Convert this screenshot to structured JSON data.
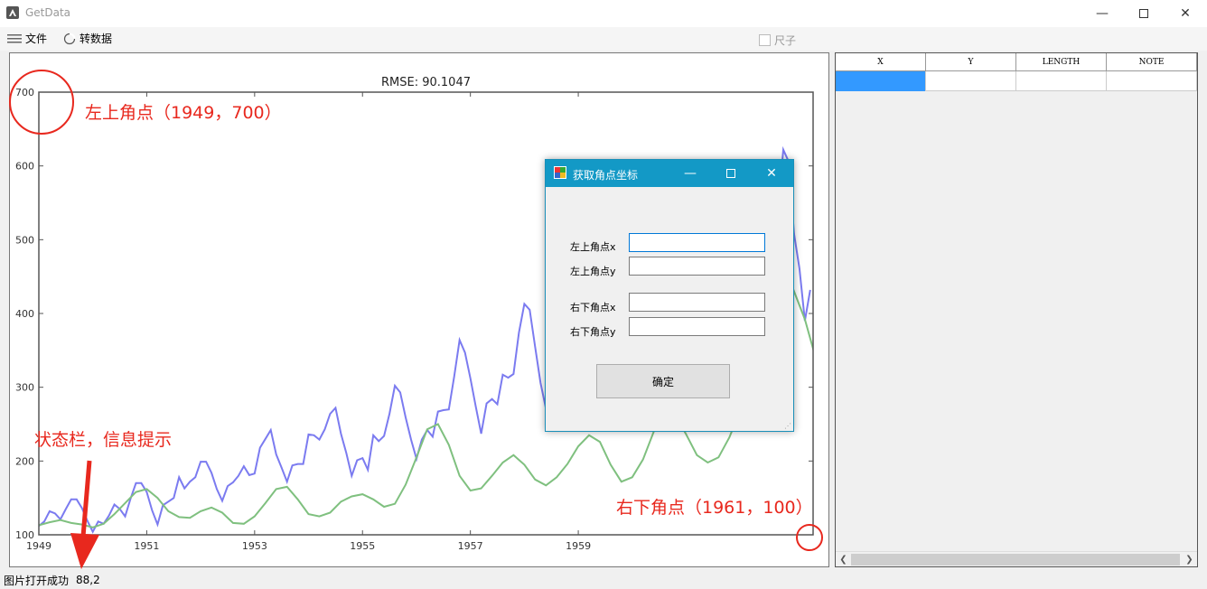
{
  "window": {
    "title": "GetData"
  },
  "menu": {
    "file": "文件",
    "convert": "转数据",
    "ruler": "尺子"
  },
  "chart_data": {
    "type": "line",
    "title": "RMSE: 90.1047",
    "xlabel": "",
    "ylabel": "",
    "xlim": [
      1949,
      1961
    ],
    "ylim": [
      100,
      700
    ],
    "xticks": [
      1949,
      1951,
      1953,
      1955,
      1957,
      1959
    ],
    "yticks": [
      100,
      200,
      300,
      400,
      500,
      600,
      700
    ],
    "grid": false,
    "legend": "none",
    "series": [
      {
        "color": "#7b7bf0",
        "points": [
          [
            1949.0,
            112
          ],
          [
            1949.1,
            118
          ],
          [
            1949.2,
            132
          ],
          [
            1949.3,
            129
          ],
          [
            1949.4,
            121
          ],
          [
            1949.5,
            135
          ],
          [
            1949.6,
            148
          ],
          [
            1949.7,
            148
          ],
          [
            1949.8,
            136
          ],
          [
            1949.9,
            119
          ],
          [
            1950.0,
            104
          ],
          [
            1950.1,
            118
          ],
          [
            1950.2,
            115
          ],
          [
            1950.3,
            126
          ],
          [
            1950.4,
            141
          ],
          [
            1950.5,
            135
          ],
          [
            1950.6,
            125
          ],
          [
            1950.7,
            149
          ],
          [
            1950.8,
            170
          ],
          [
            1950.9,
            170
          ],
          [
            1951.0,
            158
          ],
          [
            1951.1,
            133
          ],
          [
            1951.2,
            114
          ],
          [
            1951.3,
            140
          ],
          [
            1951.4,
            145
          ],
          [
            1951.5,
            150
          ],
          [
            1951.6,
            178
          ],
          [
            1951.7,
            163
          ],
          [
            1951.8,
            172
          ],
          [
            1951.9,
            178
          ],
          [
            1952.0,
            199
          ],
          [
            1952.1,
            199
          ],
          [
            1952.2,
            184
          ],
          [
            1952.3,
            162
          ],
          [
            1952.4,
            146
          ],
          [
            1952.5,
            166
          ],
          [
            1952.6,
            171
          ],
          [
            1952.7,
            180
          ],
          [
            1952.8,
            193
          ],
          [
            1952.9,
            181
          ],
          [
            1953.0,
            183
          ],
          [
            1953.1,
            218
          ],
          [
            1953.2,
            230
          ],
          [
            1953.3,
            242
          ],
          [
            1953.4,
            209
          ],
          [
            1953.5,
            191
          ],
          [
            1953.6,
            172
          ],
          [
            1953.7,
            194
          ],
          [
            1953.8,
            196
          ],
          [
            1953.9,
            196
          ],
          [
            1954.0,
            236
          ],
          [
            1954.1,
            235
          ],
          [
            1954.2,
            229
          ],
          [
            1954.3,
            243
          ],
          [
            1954.4,
            264
          ],
          [
            1954.5,
            272
          ],
          [
            1954.6,
            237
          ],
          [
            1954.7,
            211
          ],
          [
            1954.8,
            180
          ],
          [
            1954.9,
            201
          ],
          [
            1955.0,
            204
          ],
          [
            1955.1,
            188
          ],
          [
            1955.2,
            235
          ],
          [
            1955.3,
            227
          ],
          [
            1955.4,
            234
          ],
          [
            1955.5,
            264
          ],
          [
            1955.6,
            302
          ],
          [
            1955.7,
            293
          ],
          [
            1955.8,
            259
          ],
          [
            1955.9,
            229
          ],
          [
            1956.0,
            203
          ],
          [
            1956.1,
            229
          ],
          [
            1956.2,
            242
          ],
          [
            1956.3,
            233
          ],
          [
            1956.4,
            267
          ],
          [
            1956.5,
            269
          ],
          [
            1956.6,
            270
          ],
          [
            1956.7,
            315
          ],
          [
            1956.8,
            364
          ],
          [
            1956.9,
            347
          ],
          [
            1957.0,
            312
          ],
          [
            1957.1,
            274
          ],
          [
            1957.2,
            237
          ],
          [
            1957.3,
            278
          ],
          [
            1957.4,
            284
          ],
          [
            1957.5,
            277
          ],
          [
            1957.6,
            317
          ],
          [
            1957.7,
            313
          ],
          [
            1957.8,
            318
          ],
          [
            1957.9,
            374
          ],
          [
            1958.0,
            413
          ],
          [
            1958.1,
            405
          ],
          [
            1958.2,
            355
          ],
          [
            1958.3,
            306
          ],
          [
            1958.4,
            271
          ],
          [
            1958.5,
            306
          ],
          [
            1958.6,
            315
          ],
          [
            1958.7,
            301
          ],
          [
            1958.8,
            356
          ],
          [
            1958.9,
            348
          ],
          [
            1959.0,
            355
          ],
          [
            1959.1,
            422
          ],
          [
            1959.2,
            465
          ],
          [
            1959.3,
            467
          ],
          [
            1959.4,
            404
          ],
          [
            1959.5,
            347
          ],
          [
            1959.6,
            305
          ],
          [
            1959.7,
            336
          ],
          [
            1959.8,
            340
          ],
          [
            1959.9,
            318
          ],
          [
            1960.0,
            362
          ],
          [
            1960.1,
            348
          ],
          [
            1960.2,
            363
          ],
          [
            1960.3,
            435
          ],
          [
            1960.4,
            491
          ],
          [
            1960.5,
            505
          ],
          [
            1960.6,
            404
          ],
          [
            1960.7,
            359
          ],
          [
            1960.8,
            310
          ],
          [
            1960.9,
            337
          ],
          [
            1961.0,
            360
          ],
          [
            1961.1,
            342
          ],
          [
            1961.2,
            406
          ],
          [
            1961.3,
            396
          ],
          [
            1961.4,
            420
          ],
          [
            1961.5,
            472
          ],
          [
            1961.6,
            548
          ],
          [
            1961.7,
            559
          ],
          [
            1961.8,
            463
          ],
          [
            1961.9,
            407
          ],
          [
            1962.0,
            362
          ],
          [
            1962.1,
            405
          ],
          [
            1962.2,
            417
          ],
          [
            1962.3,
            391
          ],
          [
            1962.4,
            419
          ],
          [
            1962.5,
            461
          ],
          [
            1962.6,
            472
          ],
          [
            1962.7,
            535
          ],
          [
            1962.8,
            622
          ],
          [
            1962.9,
            606
          ],
          [
            1963.0,
            508
          ],
          [
            1963.1,
            461
          ],
          [
            1963.2,
            390
          ],
          [
            1963.3,
            432
          ]
        ]
      },
      {
        "color": "#7fc07f",
        "points": [
          [
            1949.0,
            113
          ],
          [
            1949.2,
            117
          ],
          [
            1949.4,
            120
          ],
          [
            1949.6,
            116
          ],
          [
            1949.8,
            114
          ],
          [
            1950.0,
            110
          ],
          [
            1950.2,
            115
          ],
          [
            1950.4,
            128
          ],
          [
            1950.6,
            143
          ],
          [
            1950.8,
            158
          ],
          [
            1951.0,
            162
          ],
          [
            1951.2,
            150
          ],
          [
            1951.4,
            132
          ],
          [
            1951.6,
            124
          ],
          [
            1951.8,
            123
          ],
          [
            1952.0,
            132
          ],
          [
            1952.2,
            137
          ],
          [
            1952.4,
            130
          ],
          [
            1952.6,
            116
          ],
          [
            1952.8,
            115
          ],
          [
            1953.0,
            125
          ],
          [
            1953.2,
            143
          ],
          [
            1953.4,
            162
          ],
          [
            1953.6,
            165
          ],
          [
            1953.8,
            148
          ],
          [
            1954.0,
            128
          ],
          [
            1954.2,
            125
          ],
          [
            1954.4,
            130
          ],
          [
            1954.6,
            145
          ],
          [
            1954.8,
            152
          ],
          [
            1955.0,
            155
          ],
          [
            1955.2,
            148
          ],
          [
            1955.4,
            138
          ],
          [
            1955.6,
            142
          ],
          [
            1955.8,
            168
          ],
          [
            1956.0,
            205
          ],
          [
            1956.2,
            243
          ],
          [
            1956.4,
            250
          ],
          [
            1956.6,
            222
          ],
          [
            1956.8,
            180
          ],
          [
            1957.0,
            160
          ],
          [
            1957.2,
            163
          ],
          [
            1957.4,
            180
          ],
          [
            1957.6,
            198
          ],
          [
            1957.8,
            208
          ],
          [
            1958.0,
            195
          ],
          [
            1958.2,
            175
          ],
          [
            1958.4,
            167
          ],
          [
            1958.6,
            178
          ],
          [
            1958.8,
            196
          ],
          [
            1959.0,
            220
          ],
          [
            1959.2,
            235
          ],
          [
            1959.4,
            226
          ],
          [
            1959.6,
            195
          ],
          [
            1959.8,
            172
          ],
          [
            1960.0,
            178
          ],
          [
            1960.2,
            202
          ],
          [
            1960.4,
            240
          ],
          [
            1960.6,
            268
          ],
          [
            1960.8,
            262
          ],
          [
            1961.0,
            236
          ],
          [
            1961.2,
            208
          ],
          [
            1961.4,
            198
          ],
          [
            1961.6,
            205
          ],
          [
            1961.8,
            232
          ],
          [
            1962.0,
            268
          ],
          [
            1962.2,
            305
          ],
          [
            1962.4,
            338
          ],
          [
            1962.6,
            365
          ],
          [
            1962.8,
            398
          ],
          [
            1963.0,
            430
          ],
          [
            1963.2,
            392
          ],
          [
            1963.4,
            340
          ],
          [
            1963.6,
            338
          ]
        ]
      }
    ]
  },
  "annotations": {
    "top_left": "左上角点（1949，700）",
    "bottom_right": "右下角点（1961，100）",
    "status_hint": "状态栏，信息提示"
  },
  "dialog": {
    "title": "获取角点坐标",
    "fields": [
      {
        "label": "左上角点x",
        "value": ""
      },
      {
        "label": "左上角点y",
        "value": ""
      },
      {
        "label": "右下角点x",
        "value": ""
      },
      {
        "label": "右下角点y",
        "value": ""
      }
    ],
    "ok_label": "确定"
  },
  "grid": {
    "columns": [
      "X",
      "Y",
      "LENGTH",
      "NOTE"
    ]
  },
  "status": {
    "message": "图片打开成功",
    "coords": "88,2"
  },
  "colors": {
    "annotation": "#e8281e",
    "dialog_title": "#1399c6",
    "selection": "#3399ff"
  }
}
